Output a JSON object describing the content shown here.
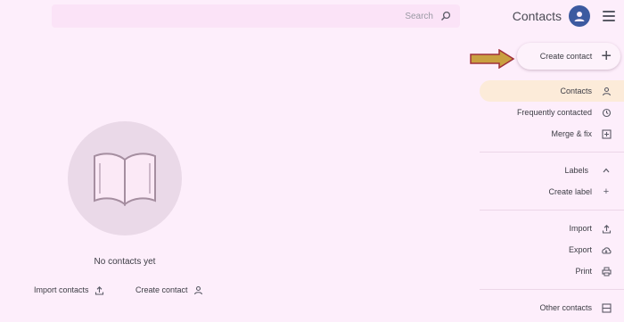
{
  "header": {
    "app_title": "Contacts"
  },
  "search": {
    "placeholder": "Search"
  },
  "create_button": {
    "label": "Create contact"
  },
  "sidebar": {
    "items": [
      {
        "label": "Contacts",
        "icon": "person-icon",
        "active": true
      },
      {
        "label": "Frequently contacted",
        "icon": "history-icon",
        "active": false
      },
      {
        "label": "Merge & fix",
        "icon": "merge-icon",
        "active": false
      }
    ],
    "labels_header": "Labels",
    "create_label": "Create label",
    "tools": [
      {
        "label": "Import",
        "icon": "upload-icon"
      },
      {
        "label": "Export",
        "icon": "cloud-download-icon"
      },
      {
        "label": "Print",
        "icon": "printer-icon"
      }
    ],
    "other_contacts": "Other contacts"
  },
  "empty_state": {
    "message": "No contacts yet",
    "create_link": "Create contact",
    "import_link": "Import contacts"
  },
  "colors": {
    "background": "#fdeefb",
    "avatar": "#3c5aa0",
    "active_item": "#fcebd9",
    "arrow": "#c9a040"
  }
}
